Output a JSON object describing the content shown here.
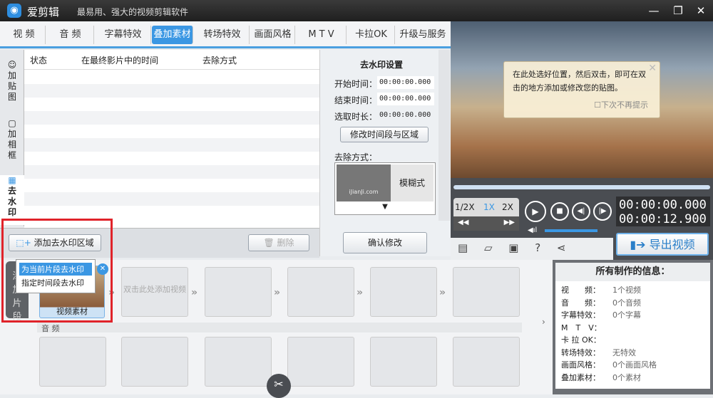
{
  "title": {
    "app": "爱剪辑",
    "slogan": "最易用、强大的视频剪辑软件"
  },
  "tabs": [
    "视 频",
    "音 频",
    "字幕特效",
    "叠加素材",
    "转场特效",
    "画面风格",
    "M T V",
    "卡拉OK",
    "升级与服务"
  ],
  "side_tabs": [
    "加贴图",
    "加相框",
    "去水印"
  ],
  "table": {
    "headers": [
      "状态",
      "在最终影片中的时间",
      "去除方式"
    ]
  },
  "settings": {
    "title": "去水印设置",
    "start_label": "开始时间：",
    "start_value": "00:00:00.000",
    "end_label": "结束时间：",
    "end_value": "00:00:00.000",
    "dur_label": "选取时长：",
    "dur_value": "00:00:00.000",
    "modify_button": "修改时间段与区域",
    "method_label": "去除方式：",
    "method_value": "模糊式",
    "thumb_text": "iJianJi.com",
    "confirm_button": "确认修改"
  },
  "bottom": {
    "add_button": "添加去水印区域",
    "delete_button": "删除"
  },
  "popup": {
    "items": [
      "为当前片段去水印",
      "指定时间段去水印"
    ]
  },
  "tip": {
    "text": "在此处选好位置，然后双击，即可在双击的地方添加或修改您的贴图。",
    "checkbox": "下次不再提示"
  },
  "player": {
    "speeds": [
      "1/2X",
      "1X",
      "2X"
    ],
    "time_current": "00:00:00.000",
    "time_total": "00:00:12.900",
    "export_button": "导出视频",
    "volume": 0.9
  },
  "timeline": {
    "add_clip": "添加片段",
    "clip_label": "视频素材",
    "empty_clip": "双击此处添加视频",
    "audio_label": "音 频"
  },
  "info": {
    "title": "所有制作的信息：",
    "rows": [
      [
        "视　　频：",
        "1个视频"
      ],
      [
        "音　　频：",
        "0个音频"
      ],
      [
        "字幕特效：",
        "0个字幕"
      ],
      [
        "M　T　V：",
        ""
      ],
      [
        "卡 拉 OK：",
        ""
      ],
      [
        "转场特效：",
        "无特效"
      ],
      [
        "画面风格：",
        "0个画面风格"
      ],
      [
        "叠加素材：",
        "0个素材"
      ]
    ]
  }
}
